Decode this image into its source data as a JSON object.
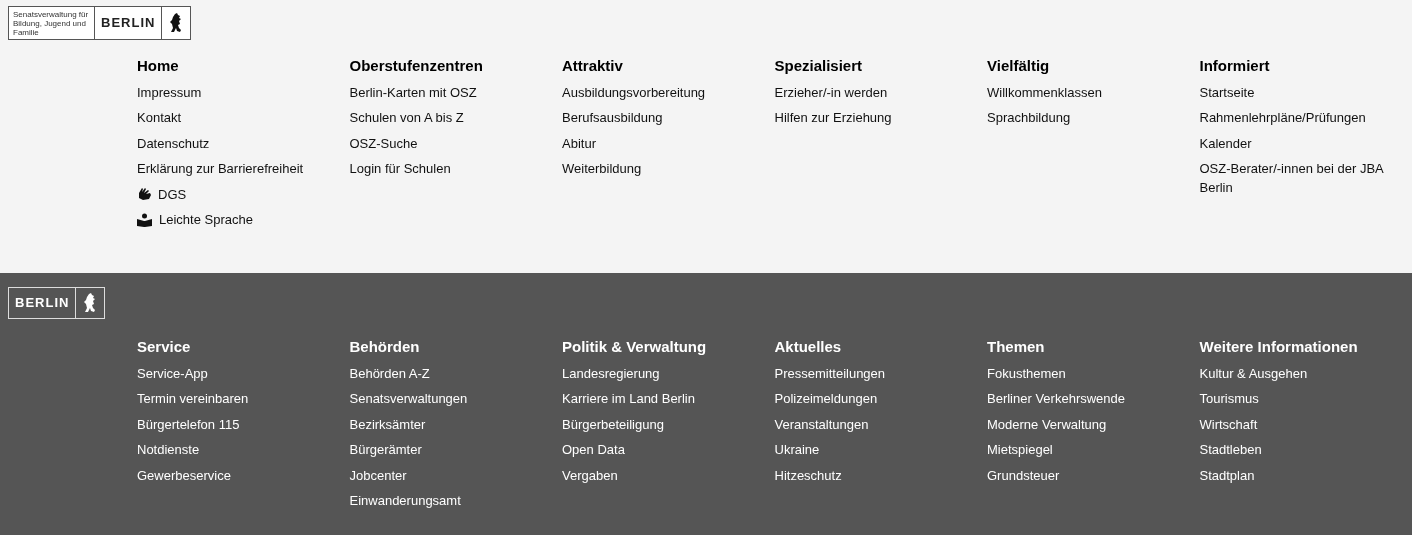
{
  "header_logo": {
    "department": "Senatsverwaltung für Bildung, Jugend und Familie",
    "wordmark": "BERLIN"
  },
  "site_nav": [
    {
      "heading": "Home",
      "links": [
        {
          "label": "Impressum",
          "kind": "text"
        },
        {
          "label": "Kontakt",
          "kind": "text"
        },
        {
          "label": "Datenschutz",
          "kind": "text"
        },
        {
          "label": "Erklärung zur Barrierefreiheit",
          "kind": "text"
        },
        {
          "label": "DGS",
          "kind": "sign-language"
        },
        {
          "label": "Leichte Sprache",
          "kind": "easy-read"
        }
      ]
    },
    {
      "heading": "Oberstufenzentren",
      "links": [
        {
          "label": "Berlin-Karten mit OSZ",
          "kind": "text"
        },
        {
          "label": "Schulen von A bis Z",
          "kind": "text"
        },
        {
          "label": "OSZ-Suche",
          "kind": "text"
        },
        {
          "label": "Login für Schulen",
          "kind": "text"
        }
      ]
    },
    {
      "heading": "Attraktiv",
      "links": [
        {
          "label": "Ausbildungsvorbereitung",
          "kind": "text"
        },
        {
          "label": "Berufsausbildung",
          "kind": "text"
        },
        {
          "label": "Abitur",
          "kind": "text"
        },
        {
          "label": "Weiterbildung",
          "kind": "text"
        }
      ]
    },
    {
      "heading": "Spezialisiert",
      "links": [
        {
          "label": "Erzieher/-in werden",
          "kind": "text"
        },
        {
          "label": "Hilfen zur Erziehung",
          "kind": "text"
        }
      ]
    },
    {
      "heading": "Vielfältig",
      "links": [
        {
          "label": "Willkommenklassen",
          "kind": "text"
        },
        {
          "label": "Sprachbildung",
          "kind": "text"
        }
      ]
    },
    {
      "heading": "Informiert",
      "links": [
        {
          "label": "Startseite",
          "kind": "text"
        },
        {
          "label": "Rahmenlehrpläne/Prüfungen",
          "kind": "text"
        },
        {
          "label": "Kalender",
          "kind": "text"
        },
        {
          "label": "OSZ-Berater/-innen bei der JBA Berlin",
          "kind": "text"
        }
      ]
    }
  ],
  "footer_logo": {
    "wordmark": "BERLIN"
  },
  "footer_nav": [
    {
      "heading": "Service",
      "links": [
        "Service-App",
        "Termin vereinbaren",
        "Bürgertelefon 115",
        "Notdienste",
        "Gewerbeservice"
      ]
    },
    {
      "heading": "Behörden",
      "links": [
        "Behörden A-Z",
        "Senatsverwaltungen",
        "Bezirksämter",
        "Bürgerämter",
        "Jobcenter",
        "Einwanderungsamt"
      ]
    },
    {
      "heading": "Politik & Verwaltung",
      "links": [
        "Landesregierung",
        "Karriere im Land Berlin",
        "Bürgerbeteiligung",
        "Open Data",
        "Vergaben"
      ]
    },
    {
      "heading": "Aktuelles",
      "links": [
        "Pressemitteilungen",
        "Polizeimeldungen",
        "Veranstaltungen",
        "Ukraine",
        "Hitzeschutz"
      ]
    },
    {
      "heading": "Themen",
      "links": [
        "Fokusthemen",
        "Berliner Verkehrswende",
        "Moderne Verwaltung",
        "Mietspiegel",
        "Grundsteuer"
      ]
    },
    {
      "heading": "Weitere Informationen",
      "links": [
        "Kultur & Ausgehen",
        "Tourismus",
        "Wirtschaft",
        "Stadtleben",
        "Stadtplan"
      ]
    }
  ]
}
